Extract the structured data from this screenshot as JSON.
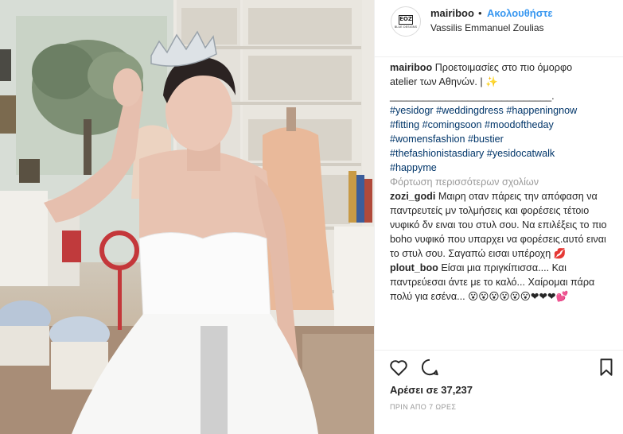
{
  "post": {
    "username": "mairiboo",
    "separator": "•",
    "follow_label": "Ακολουθήστε",
    "location": "Vassilis Emmanuel Zoulias",
    "avatar_logo_text": "EOZ",
    "avatar_logo_sub": "BLUE DESIGNS"
  },
  "caption": {
    "username": "mairiboo",
    "line1": "Προετοιμασίες στο πιο όμορφο",
    "line2": "atelier των Αθηνών. | ✨",
    "line3": "_____________________________.",
    "hashtags_line1": "#yesidogr #weddingdress #happeningnow",
    "hashtags_line2": "#fitting #comingsoon #moodoftheday",
    "hashtags_line3": "#womensfashion #bustier",
    "hashtags_line4": "#thefashionistasdiary #yesidocatwalk",
    "hashtags_line5": "#happyme"
  },
  "load_more_label": "Φόρτωση περισσότερων σχολίων",
  "comments": [
    {
      "username": "zozi_godi",
      "text": "Μαιρη οταν πάρεις την απόφαση να παντρευτείς μν τολμήσεις και φορέσεις τέτοιο νυφικό δν ειναι του στυλ σου. Να επιλέξεις το πιο boho νυφικό που υπαρχει να φορέσεις.αυτό ειναι το στυλ σου. Σαγαπώ εισαι υπέροχη 💋"
    },
    {
      "username": "plout_boo",
      "text": "Είσαι μια πριγκίπισσα.... Και παντρεύεσαι άντε με το καλό... Χαίρομαι πάρα πολύ για εσένα... 😮😮😮😮😮😮❤❤❤💕"
    }
  ],
  "footer": {
    "likes_label": "Αρέσει σε 37,237",
    "time_label": "ΠΡΙΝ ΑΠΟ 7 ΩΡΕΣ"
  },
  "icons": {
    "like": "heart-icon",
    "comment": "comment-bubble-icon",
    "save": "bookmark-icon"
  },
  "colors": {
    "follow_blue": "#3897f0",
    "hashtag": "#003569",
    "muted": "#999999",
    "text": "#262626"
  }
}
